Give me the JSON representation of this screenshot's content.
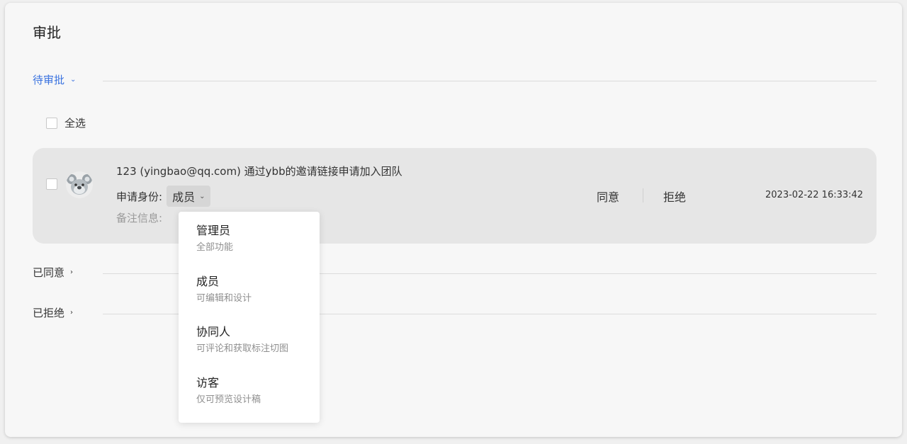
{
  "page": {
    "title": "审批"
  },
  "sections": {
    "pending": {
      "label": "待审批"
    },
    "approved": {
      "label": "已同意"
    },
    "rejected": {
      "label": "已拒绝"
    }
  },
  "select_all": {
    "label": "全选"
  },
  "request": {
    "text": "123 (yingbao@qq.com) 通过ybb的邀请链接申请加入团队",
    "role_label": "申请身份:",
    "role_value": "成员",
    "note_label": "备注信息:",
    "approve_label": "同意",
    "reject_label": "拒绝",
    "timestamp": "2023-02-22 16:33:42"
  },
  "role_dropdown": {
    "options": [
      {
        "title": "管理员",
        "desc": "全部功能"
      },
      {
        "title": "成员",
        "desc": "可编辑和设计"
      },
      {
        "title": "协同人",
        "desc": "可评论和获取标注切图"
      },
      {
        "title": "访客",
        "desc": "仅可预览设计稿"
      }
    ]
  },
  "colors": {
    "accent": "#3b73e0",
    "row_bg": "#e6e6e6",
    "card_bg": "#f7f7f7"
  },
  "icons": {
    "pending_chevron": "chevron-down-icon",
    "approved_chevron": "chevron-right-icon",
    "rejected_chevron": "chevron-right-icon",
    "role_chevron": "chevron-down-icon",
    "avatar": "koala-avatar"
  }
}
